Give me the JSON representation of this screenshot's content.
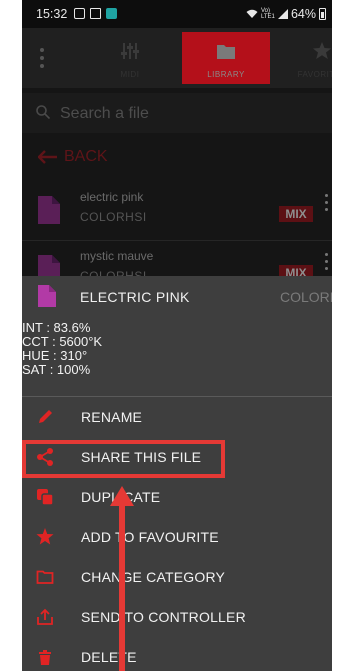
{
  "status_bar": {
    "time": "15:32",
    "network": "Vo) LTE1",
    "battery": "64%"
  },
  "nav": {
    "tabs": [
      {
        "label": "MIDI",
        "icon": "sliders-icon",
        "active": false
      },
      {
        "label": "LIBRARY",
        "icon": "folder-icon",
        "active": true
      },
      {
        "label": "FAVORITES",
        "icon": "star-icon",
        "active": false
      }
    ]
  },
  "search": {
    "placeholder": "Search a file"
  },
  "back": {
    "label": "BACK"
  },
  "files": [
    {
      "name": "electric pink",
      "category": "COLORHSI",
      "badge": "MIX"
    },
    {
      "name": "mystic mauve",
      "category": "COLORHSI",
      "badge": "MIX"
    }
  ],
  "sheet": {
    "title": "ELECTRIC PINK",
    "category": "COLORHSI",
    "info": {
      "int": "INT : 83.6%",
      "cct": "CCT : 5600°K",
      "hue": "HUE : 310°",
      "sat": "SAT : 100%"
    },
    "menu": [
      {
        "label": "RENAME",
        "icon": "pencil-icon"
      },
      {
        "label": "SHARE THIS FILE",
        "icon": "share-icon"
      },
      {
        "label": "DUPLICATE",
        "icon": "duplicate-icon"
      },
      {
        "label": "ADD TO FAVOURITE",
        "icon": "star-icon"
      },
      {
        "label": "CHANGE CATEGORY",
        "icon": "folder-outline-icon"
      },
      {
        "label": "SEND TO CONTROLLER",
        "icon": "upload-icon"
      },
      {
        "label": "DELETE",
        "icon": "trash-icon"
      }
    ]
  },
  "colors": {
    "accent": "#e02424",
    "file_icon": "#b23aa6",
    "annotation": "#e53935"
  }
}
